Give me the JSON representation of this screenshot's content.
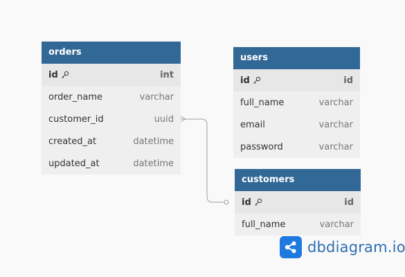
{
  "tables": {
    "orders": {
      "name": "orders",
      "columns": [
        {
          "name": "id",
          "type": "int",
          "pk": true
        },
        {
          "name": "order_name",
          "type": "varchar",
          "pk": false
        },
        {
          "name": "customer_id",
          "type": "uuid",
          "pk": false
        },
        {
          "name": "created_at",
          "type": "datetime",
          "pk": false
        },
        {
          "name": "updated_at",
          "type": "datetime",
          "pk": false
        }
      ]
    },
    "users": {
      "name": "users",
      "columns": [
        {
          "name": "id",
          "type": "id",
          "pk": true
        },
        {
          "name": "full_name",
          "type": "varchar",
          "pk": false
        },
        {
          "name": "email",
          "type": "varchar",
          "pk": false
        },
        {
          "name": "password",
          "type": "varchar",
          "pk": false
        }
      ]
    },
    "customers": {
      "name": "customers",
      "columns": [
        {
          "name": "id",
          "type": "id",
          "pk": true
        },
        {
          "name": "full_name",
          "type": "varchar",
          "pk": false
        }
      ]
    }
  },
  "relationships": [
    {
      "from": "orders.customer_id",
      "to": "customers.id",
      "from_cardinality": "many",
      "to_cardinality": "one"
    }
  ],
  "brand": {
    "name": "dbdiagram.io",
    "logo_icon": "share-nodes-icon"
  },
  "colors": {
    "header": "#316896",
    "background": "#f9f9f9",
    "row": "#efefef",
    "connector": "#a0a0a0",
    "brand": "#1f7ae0"
  }
}
